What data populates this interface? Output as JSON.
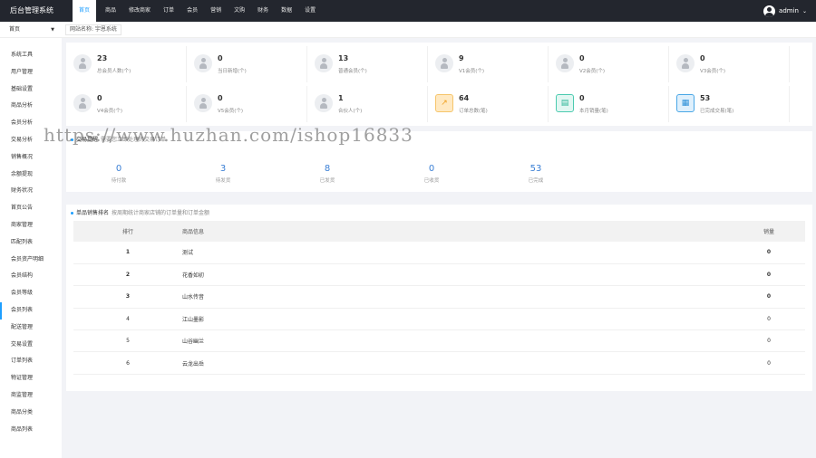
{
  "app": {
    "title": "后台管理系统"
  },
  "topnav": [
    {
      "label": "首页",
      "active": true
    },
    {
      "label": "商品"
    },
    {
      "label": "修改商家"
    },
    {
      "label": "订单"
    },
    {
      "label": "会员"
    },
    {
      "label": "营销"
    },
    {
      "label": "文购"
    },
    {
      "label": "财务"
    },
    {
      "label": "数据"
    },
    {
      "label": "设置"
    }
  ],
  "user": {
    "name": "admin"
  },
  "sidebar": {
    "home_label": "首页",
    "items": [
      "系统工具",
      "用户管理",
      "基础设置",
      "商品分析",
      "会员分析",
      "交易分析",
      "销售概况",
      "余额提现",
      "财务状况",
      "首页公告",
      "商家管理",
      "匹配列表",
      "会员资产明细",
      "会员结构",
      "会员等级",
      "会员列表",
      "配送管理",
      "交易设置",
      "订单列表",
      "物证管理",
      "商监管理",
      "商品分类",
      "商品列表"
    ]
  },
  "breadcrumb": {
    "label": "网站名称: 宇恩系统"
  },
  "stats": [
    {
      "value": "23",
      "label": "总会员人数(个)",
      "icon": "user-icon"
    },
    {
      "value": "0",
      "label": "当日新增(个)",
      "icon": "user-icon"
    },
    {
      "value": "13",
      "label": "普通会员(个)",
      "icon": "user-icon"
    },
    {
      "value": "9",
      "label": "V1会员(个)",
      "icon": "user-icon"
    },
    {
      "value": "0",
      "label": "V2会员(个)",
      "icon": "user-icon"
    },
    {
      "value": "0",
      "label": "V3会员(个)",
      "icon": "user-icon"
    },
    {
      "value": "0",
      "label": "V4会员(个)",
      "icon": "user-icon"
    },
    {
      "value": "0",
      "label": "V5会员(个)",
      "icon": "user-icon"
    },
    {
      "value": "1",
      "label": "合伙人(个)",
      "icon": "user-icon"
    },
    {
      "value": "64",
      "label": "订单总数(笔)",
      "icon": "chart-icon"
    },
    {
      "value": "0",
      "label": "本月销量(笔)",
      "icon": "clipboard-icon"
    },
    {
      "value": "53",
      "label": "已完成交易(笔)",
      "icon": "calendar-icon"
    }
  ],
  "orders": {
    "title": "交易提醒",
    "subtitle": "需要您立即处理的交易订单",
    "items": [
      {
        "value": "0",
        "label": "待付款"
      },
      {
        "value": "3",
        "label": "待发货"
      },
      {
        "value": "8",
        "label": "已发货"
      },
      {
        "value": "0",
        "label": "已收货"
      },
      {
        "value": "53",
        "label": "已完成"
      }
    ]
  },
  "ranking": {
    "title": "单品销售排名",
    "subtitle": "按周期统计商家店铺的订单量和订单金额",
    "headers": {
      "rank": "排行",
      "name": "商品信息",
      "sales": "销量"
    },
    "rows": [
      {
        "rank": "1",
        "name": "测试",
        "sales": "0"
      },
      {
        "rank": "2",
        "name": "花香如初",
        "sales": "0"
      },
      {
        "rank": "3",
        "name": "山水传音",
        "sales": "0"
      },
      {
        "rank": "4",
        "name": "江山墨影",
        "sales": "0"
      },
      {
        "rank": "5",
        "name": "山谷幽兰",
        "sales": "0"
      },
      {
        "rank": "6",
        "name": "云龙出岳",
        "sales": "0"
      }
    ]
  },
  "watermark": "https://www.huzhan.com/ishop16833",
  "colors": {
    "topbar": "#23262e",
    "accent": "#1e9fff",
    "rank1": "#ff3d2e",
    "rank2": "#ff9a1e",
    "rank3": "#1e9fff"
  }
}
